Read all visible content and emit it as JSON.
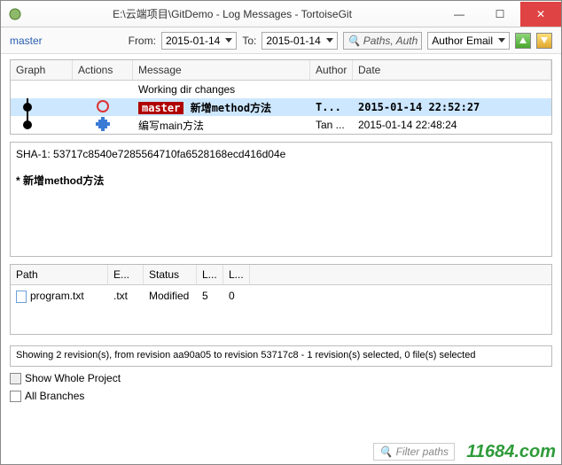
{
  "window": {
    "title": "E:\\云端项目\\GitDemo - Log Messages - TortoiseGit"
  },
  "toolbar": {
    "branch": "master",
    "from_label": "From:",
    "from_date": "2015-01-14",
    "to_label": "To:",
    "to_date": "2015-01-14",
    "paths_btn": "Paths, Auth",
    "author_filter": "Author Email"
  },
  "columns": {
    "graph": "Graph",
    "actions": "Actions",
    "message": "Message",
    "author": "Author",
    "date": "Date"
  },
  "commits": [
    {
      "msg": "Working dir changes",
      "author": "",
      "date": "",
      "tag": "",
      "action": ""
    },
    {
      "msg": "新增method方法",
      "author": "T...",
      "date": "2015-01-14 22:52:27",
      "tag": "master",
      "action": "red",
      "selected": true
    },
    {
      "msg": "编写main方法",
      "author": "Tan ...",
      "date": "2015-01-14 22:48:24",
      "tag": "",
      "action": "blue"
    }
  ],
  "details": {
    "sha_label": "SHA-1:",
    "sha": "53717c8540e7285564710fa6528168ecd416d04e",
    "bullet": "* 新增method方法"
  },
  "file_columns": {
    "path": "Path",
    "ext": "E...",
    "status": "Status",
    "add": "L...",
    "rem": "L..."
  },
  "files": [
    {
      "path": "program.txt",
      "ext": ".txt",
      "status": "Modified",
      "add": "5",
      "rem": "0"
    }
  ],
  "status_line": "Showing 2 revision(s), from revision aa90a05 to revision 53717c8 - 1 revision(s) selected, 0 file(s) selected",
  "bottom": {
    "show_whole": "Show Whole Project",
    "all_branches": "All Branches",
    "filter_placeholder": "Filter paths"
  },
  "watermark": "11684.com"
}
